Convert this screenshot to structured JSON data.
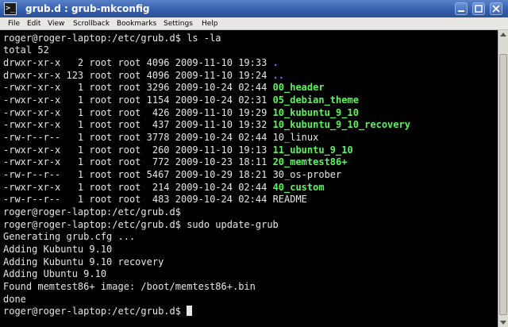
{
  "window": {
    "title": "grub.d : grub-mkconfig",
    "icon_label": ">_",
    "title_color": "#3560ac"
  },
  "window_buttons": [
    {
      "name": "minimize-button",
      "icon": "minimize-icon"
    },
    {
      "name": "maximize-button",
      "icon": "maximize-icon"
    },
    {
      "name": "close-button",
      "icon": "close-icon"
    }
  ],
  "menubar": {
    "items": [
      "File",
      "Edit",
      "View",
      "Scrollback",
      "Bookmarks",
      "Settings",
      "Help"
    ]
  },
  "terminal": {
    "prompt": "roger@roger-laptop:/etc/grub.d$",
    "command_1": "roger@roger-laptop:/etc/grub.d$ ls -la",
    "total": "total 52",
    "listing": [
      {
        "meta": "drwxr-xr-x   2 root root 4096 2009-11-10 19:33 ",
        "name": ".",
        "kind": "dir"
      },
      {
        "meta": "drwxr-xr-x 123 root root 4096 2009-11-10 19:24 ",
        "name": "..",
        "kind": "dir"
      },
      {
        "meta": "-rwxr-xr-x   1 root root 3296 2009-10-24 02:44 ",
        "name": "00_header",
        "kind": "exec"
      },
      {
        "meta": "-rwxr-xr-x   1 root root 1154 2009-10-24 02:31 ",
        "name": "05_debian_theme",
        "kind": "exec"
      },
      {
        "meta": "-rwxr-xr-x   1 root root  426 2009-11-10 19:29 ",
        "name": "10_kubuntu_9_10",
        "kind": "exec"
      },
      {
        "meta": "-rwxr-xr-x   1 root root  437 2009-11-10 19:32 ",
        "name": "10_kubuntu_9_10_recovery",
        "kind": "exec"
      },
      {
        "meta": "-rw-r--r--   1 root root 3778 2009-10-24 02:44 ",
        "name": "10_linux",
        "kind": "plain"
      },
      {
        "meta": "-rwxr-xr-x   1 root root  260 2009-11-10 19:13 ",
        "name": "11_ubuntu_9_10",
        "kind": "exec"
      },
      {
        "meta": "-rwxr-xr-x   1 root root  772 2009-10-23 18:11 ",
        "name": "20_memtest86+",
        "kind": "exec"
      },
      {
        "meta": "-rw-r--r--   1 root root 5467 2009-10-29 18:21 ",
        "name": "30_os-prober",
        "kind": "plain"
      },
      {
        "meta": "-rwxr-xr-x   1 root root  214 2009-10-24 02:44 ",
        "name": "40_custom",
        "kind": "exec"
      },
      {
        "meta": "-rw-r--r--   1 root root  483 2009-10-24 02:44 ",
        "name": "README",
        "kind": "plain"
      }
    ],
    "after_listing_prompt": "roger@roger-laptop:/etc/grub.d$",
    "command_2": "roger@roger-laptop:/etc/grub.d$ sudo update-grub",
    "output": [
      "Generating grub.cfg ...",
      "Adding Kubuntu 9.10",
      "Adding Kubuntu 9.10 recovery",
      "Adding Ubuntu 9.10",
      "Found memtest86+ image: /boot/memtest86+.bin",
      "done"
    ],
    "final_prompt": "roger@roger-laptop:/etc/grub.d$ ",
    "colors": {
      "background": "#000000",
      "text": "#e6e6e6",
      "executable": "#5cf35c",
      "directory": "#5f7fff"
    }
  },
  "scrollbar": {
    "position_fraction": 1.0,
    "visible_fraction": 0.95
  }
}
